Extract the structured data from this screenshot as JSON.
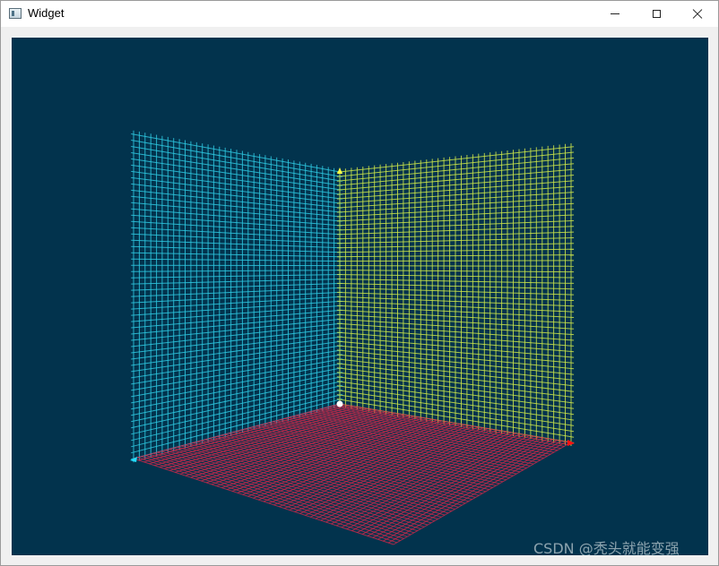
{
  "window": {
    "title": "Widget",
    "icon": "app-window-icon",
    "controls": [
      "minimize-icon",
      "maximize-icon",
      "close-icon"
    ]
  },
  "scene": {
    "background": "#02334d",
    "walls": [
      {
        "name": "left-wall",
        "color": "#2ec8e0"
      },
      {
        "name": "right-wall",
        "color": "#cde44a"
      },
      {
        "name": "floor",
        "color": "#d8284a"
      }
    ],
    "axis_markers": [
      {
        "name": "y-axis-marker",
        "color": "#ffff44"
      },
      {
        "name": "x-axis-marker",
        "color": "#ff1111"
      },
      {
        "name": "z-axis-marker",
        "color": "#22ddff"
      },
      {
        "name": "origin-marker",
        "color": "#ffffff"
      }
    ]
  },
  "watermark": "CSDN @秃头就能变强"
}
